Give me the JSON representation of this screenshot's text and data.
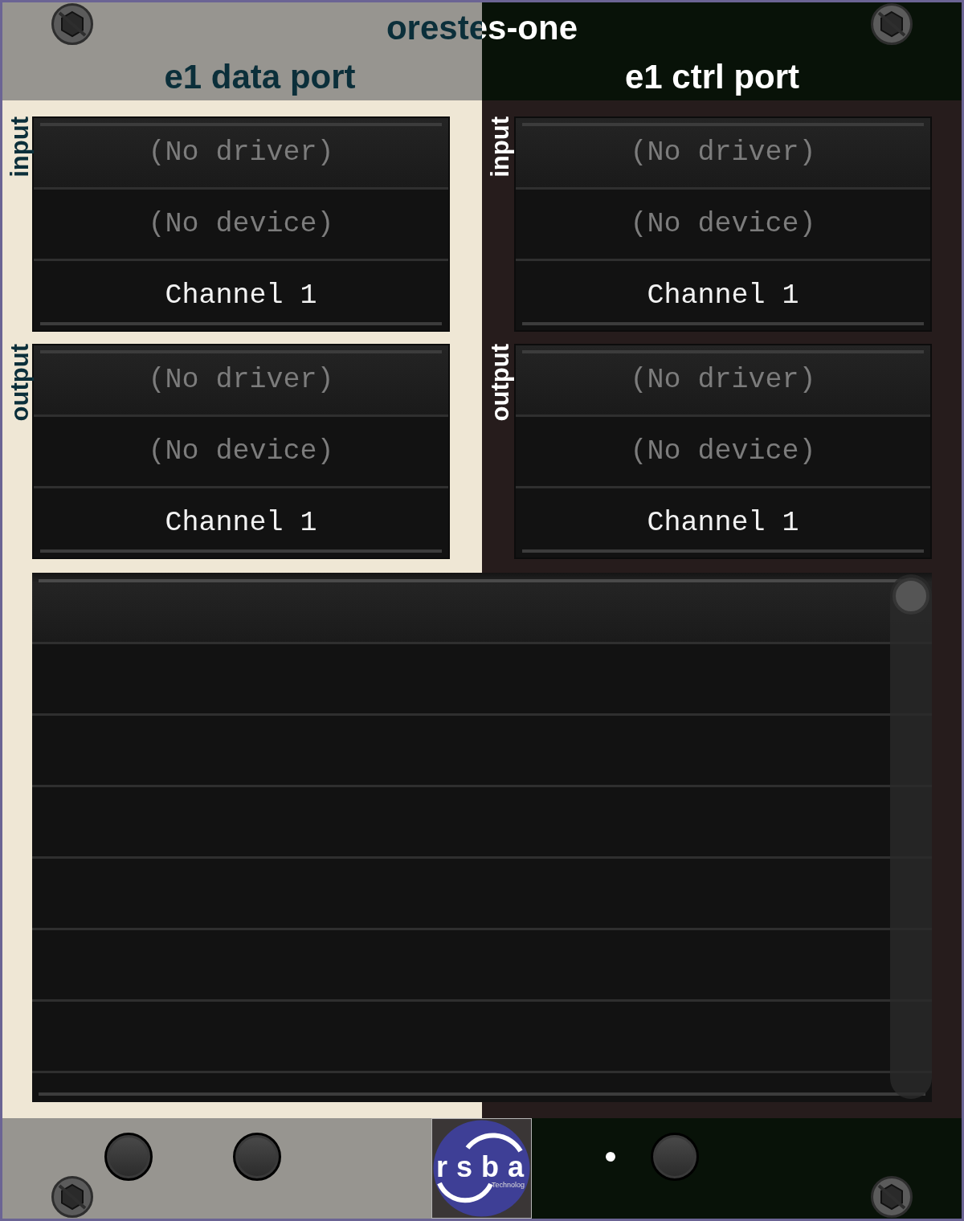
{
  "panel": {
    "title": "orestes-one"
  },
  "sections": [
    {
      "title": "e1 data port",
      "kind": "light",
      "ports": [
        {
          "label": "input",
          "rows": [
            {
              "kind": "driver",
              "text": "(No driver)",
              "dimmed": true
            },
            {
              "kind": "device",
              "text": "(No device)",
              "dimmed": true
            },
            {
              "kind": "channel",
              "text": "Channel 1",
              "dimmed": false
            }
          ]
        },
        {
          "label": "output",
          "rows": [
            {
              "kind": "driver",
              "text": "(No driver)",
              "dimmed": true
            },
            {
              "kind": "device",
              "text": "(No device)",
              "dimmed": true
            },
            {
              "kind": "channel",
              "text": "Channel 1",
              "dimmed": false
            }
          ]
        }
      ]
    },
    {
      "title": "e1 ctrl port",
      "kind": "dark",
      "ports": [
        {
          "label": "input",
          "rows": [
            {
              "kind": "driver",
              "text": "(No driver)",
              "dimmed": true
            },
            {
              "kind": "device",
              "text": "(No device)",
              "dimmed": true
            },
            {
              "kind": "channel",
              "text": "Channel 1",
              "dimmed": false
            }
          ]
        },
        {
          "label": "output",
          "rows": [
            {
              "kind": "driver",
              "text": "(No driver)",
              "dimmed": true
            },
            {
              "kind": "device",
              "text": "(No device)",
              "dimmed": true
            },
            {
              "kind": "channel",
              "text": "Channel 1",
              "dimmed": false
            }
          ]
        }
      ]
    }
  ],
  "logo": {
    "wordmark": "rsba",
    "tagline": "Technolog"
  }
}
